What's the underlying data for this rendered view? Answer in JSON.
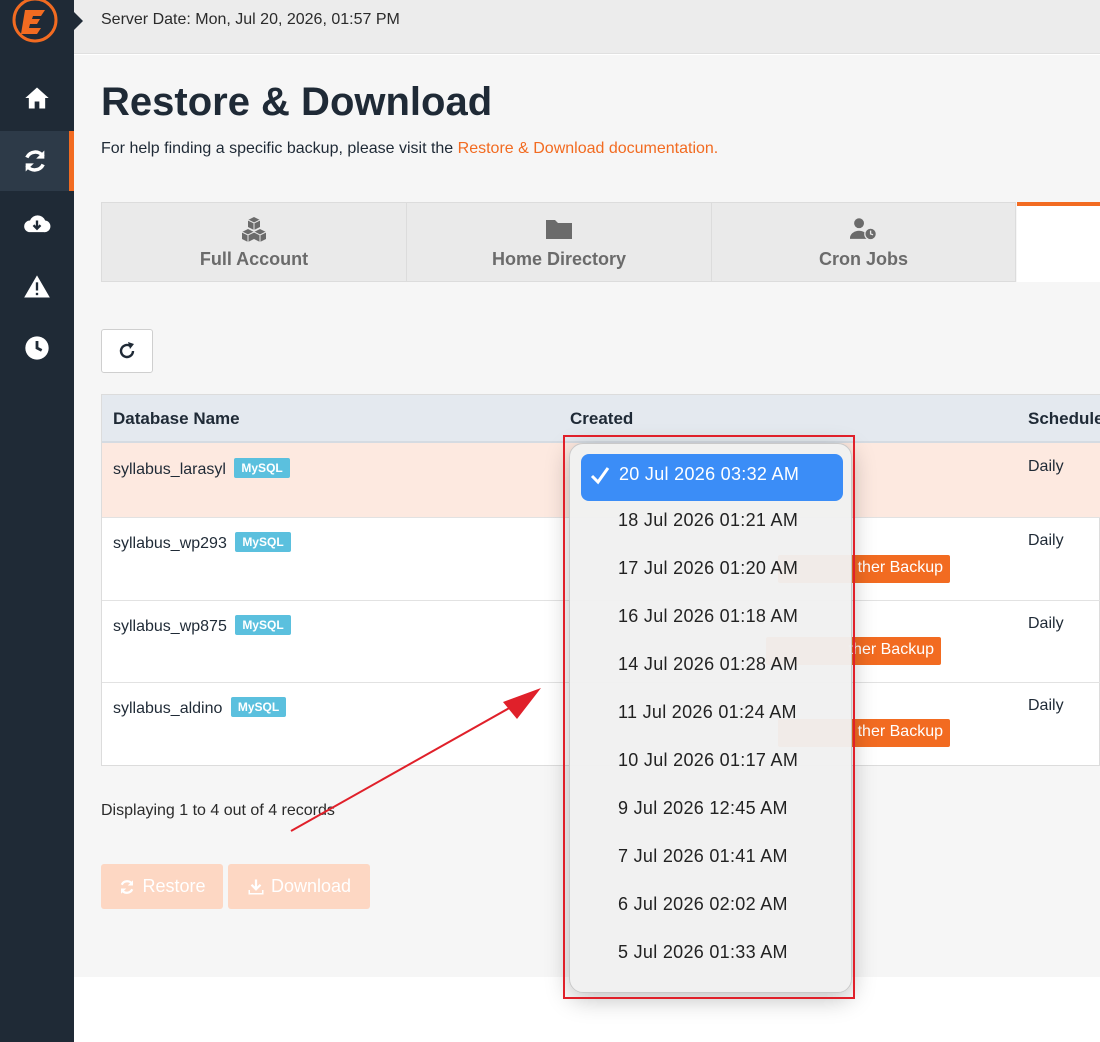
{
  "topbar": {
    "server_date": "Server Date: Mon, Jul 20, 2026, 01:57 PM"
  },
  "sidebar": {
    "items": [
      {
        "icon": "home-icon"
      },
      {
        "icon": "sync-icon",
        "active": true
      },
      {
        "icon": "cloud-download-icon"
      },
      {
        "icon": "warning-icon"
      },
      {
        "icon": "clock-icon"
      }
    ]
  },
  "page": {
    "title": "Restore & Download",
    "help_prefix": "For help finding a specific backup, please visit the",
    "help_link": "Restore & Download documentation."
  },
  "tabs": [
    {
      "label": "Full Account",
      "icon": "cubes-icon"
    },
    {
      "label": "Home Directory",
      "icon": "folder-icon"
    },
    {
      "label": "Cron Jobs",
      "icon": "user-clock-icon"
    }
  ],
  "table": {
    "headers": {
      "name": "Database Name",
      "created": "Created",
      "schedule": "Schedule"
    },
    "rows": [
      {
        "name": "syllabus_larasyl",
        "badge": "MySQL",
        "schedule": "Daily",
        "selected": true
      },
      {
        "name": "syllabus_wp293",
        "badge": "MySQL",
        "schedule": "Daily",
        "other": "ther Backup"
      },
      {
        "name": "syllabus_wp875",
        "badge": "MySQL",
        "schedule": "Daily",
        "other": "ther Backup"
      },
      {
        "name": "syllabus_aldino",
        "badge": "MySQL",
        "schedule": "Daily",
        "other": "ther Backup"
      }
    ]
  },
  "records": "Displaying 1 to 4 out of 4 records",
  "buttons": {
    "restore": "Restore",
    "download": "Download"
  },
  "dropdown": {
    "selected": "20 Jul 2026 03:32 AM",
    "options": [
      "18 Jul 2026 01:21 AM",
      "17 Jul 2026 01:20 AM",
      "16 Jul 2026 01:18 AM",
      "14 Jul 2026 01:28 AM",
      "11 Jul 2026 01:24 AM",
      "10 Jul 2026 01:17 AM",
      "9 Jul 2026 12:45 AM",
      "7 Jul 2026 01:41 AM",
      "6 Jul 2026 02:02 AM",
      "5 Jul 2026 01:33 AM"
    ]
  },
  "colors": {
    "accent": "#f26b21",
    "sidebar": "#1f2a36",
    "badge": "#5bc0de",
    "selection": "#3b8df7",
    "annotation": "#e0202a"
  }
}
